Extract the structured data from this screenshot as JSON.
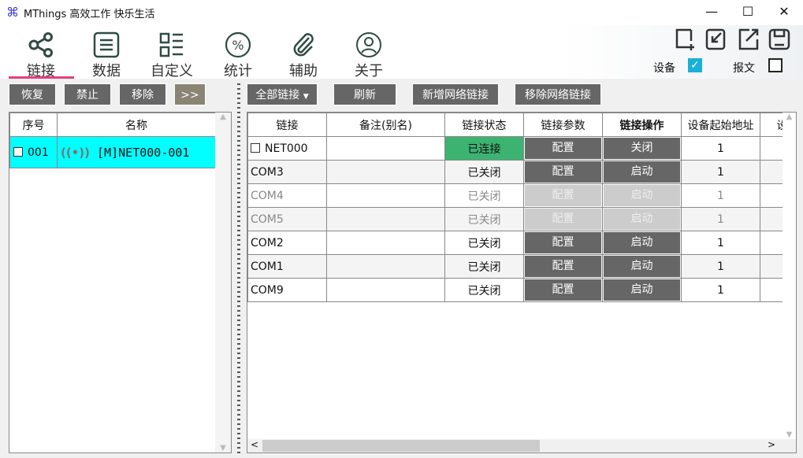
{
  "window": {
    "title": "MThings 高效工作 快乐生活",
    "icon": "command-icon",
    "minimize": "—",
    "maximize": "☐",
    "close": "✕"
  },
  "nav": {
    "items": [
      {
        "label": "链接",
        "icon": "share-icon"
      },
      {
        "label": "数据",
        "icon": "list-icon"
      },
      {
        "label": "自定义",
        "icon": "layout-icon"
      },
      {
        "label": "统计",
        "icon": "percent-icon"
      },
      {
        "label": "辅助",
        "icon": "paperclip-icon"
      },
      {
        "label": "关于",
        "icon": "user-icon"
      }
    ],
    "active": "链接"
  },
  "actions": {
    "icons": [
      "new-window-icon",
      "import-icon",
      "export-icon",
      "save-icon"
    ],
    "device_label": "设备",
    "device_checked": true,
    "message_label": "报文",
    "message_checked": false
  },
  "left_toolbar": {
    "restore": "恢复",
    "disable": "禁止",
    "remove": "移除",
    "expand": ">>"
  },
  "right_toolbar": {
    "filter": "全部链接",
    "refresh": "刷新",
    "add_network": "新增网络链接",
    "remove_network": "移除网络链接"
  },
  "device_list": {
    "headers": [
      "序号",
      "名称"
    ],
    "rows": [
      {
        "index": "001",
        "name": "[M]NET000-001",
        "checked": false
      }
    ]
  },
  "link_table": {
    "headers": [
      "链接",
      "备注(别名)",
      "链接状态",
      "链接参数",
      "链接操作",
      "设备起始地址",
      "设备"
    ],
    "rows": [
      {
        "link": "NET000",
        "alias": "",
        "status": "已连接",
        "param": "配置",
        "op": "关闭",
        "addr": "1",
        "checkbox": true,
        "enabled": true,
        "connected": true
      },
      {
        "link": "COM3",
        "alias": "",
        "status": "已关闭",
        "param": "配置",
        "op": "启动",
        "addr": "1",
        "enabled": true
      },
      {
        "link": "COM4",
        "alias": "",
        "status": "已关闭",
        "param": "配置",
        "op": "启动",
        "addr": "1",
        "enabled": false
      },
      {
        "link": "COM5",
        "alias": "",
        "status": "已关闭",
        "param": "配置",
        "op": "启动",
        "addr": "1",
        "enabled": false
      },
      {
        "link": "COM2",
        "alias": "",
        "status": "已关闭",
        "param": "配置",
        "op": "启动",
        "addr": "1",
        "enabled": true
      },
      {
        "link": "COM1",
        "alias": "",
        "status": "已关闭",
        "param": "配置",
        "op": "启动",
        "addr": "1",
        "enabled": true
      },
      {
        "link": "COM9",
        "alias": "",
        "status": "已关闭",
        "param": "配置",
        "op": "启动",
        "addr": "1",
        "enabled": true
      }
    ]
  },
  "colors": {
    "accent_underline": "#e83e7e",
    "selected_row": "#00ffff",
    "connected": "#3cb371",
    "button": "#666666",
    "checkbox": "#1ab0d8"
  }
}
